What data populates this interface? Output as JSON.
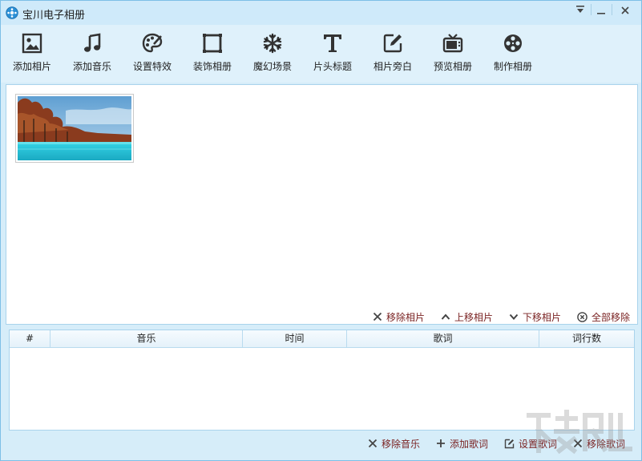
{
  "window": {
    "title": "宝川电子相册"
  },
  "toolbar": {
    "items": [
      {
        "label": "添加相片",
        "icon": "image-icon"
      },
      {
        "label": "添加音乐",
        "icon": "music-note-icon"
      },
      {
        "label": "设置特效",
        "icon": "palette-icon"
      },
      {
        "label": "装饰相册",
        "icon": "frame-icon"
      },
      {
        "label": "魔幻场景",
        "icon": "snowflake-icon"
      },
      {
        "label": "片头标题",
        "icon": "text-t-icon"
      },
      {
        "label": "相片旁白",
        "icon": "edit-icon"
      },
      {
        "label": "预览相册",
        "icon": "tv-icon"
      },
      {
        "label": "制作相册",
        "icon": "film-reel-icon"
      }
    ]
  },
  "photo_actions": {
    "remove": "移除相片",
    "move_up": "上移相片",
    "move_down": "下移相片",
    "remove_all": "全部移除"
  },
  "music_table": {
    "columns": [
      "#",
      "音乐",
      "时间",
      "歌词",
      "词行数"
    ],
    "rows": []
  },
  "music_actions": {
    "remove_music": "移除音乐",
    "add_lyrics": "添加歌词",
    "set_lyrics": "设置歌词",
    "remove_lyrics": "移除歌词"
  },
  "colors": {
    "window_bg": "#d6edf9",
    "action_text": "#7a2222",
    "border": "#a9d3ec"
  }
}
